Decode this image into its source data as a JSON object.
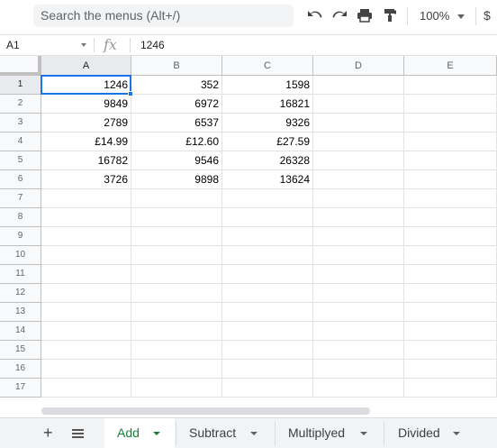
{
  "toolbar": {
    "search_placeholder": "Search the menus (Alt+/)",
    "undo_icon": "undo-icon",
    "redo_icon": "redo-icon",
    "print_icon": "print-icon",
    "paint_format_icon": "paint-format-icon",
    "zoom": "100%",
    "currency": "$"
  },
  "formula_bar": {
    "cell_ref": "A1",
    "fx": "fx",
    "value": "1246"
  },
  "columns": [
    "A",
    "B",
    "C",
    "D",
    "E"
  ],
  "rows": [
    "1",
    "2",
    "3",
    "4",
    "5",
    "6",
    "7",
    "8",
    "9",
    "10",
    "11",
    "12",
    "13",
    "14",
    "15",
    "16",
    "17"
  ],
  "cells": [
    [
      "1246",
      "352",
      "1598",
      "",
      ""
    ],
    [
      "9849",
      "6972",
      "16821",
      "",
      ""
    ],
    [
      "2789",
      "6537",
      "9326",
      "",
      ""
    ],
    [
      "£14.99",
      "£12.60",
      "£27.59",
      "",
      ""
    ],
    [
      "16782",
      "9546",
      "26328",
      "",
      ""
    ],
    [
      "3726",
      "9898",
      "13624",
      "",
      ""
    ]
  ],
  "sheets": {
    "add_icon": "+",
    "tabs": [
      "Add",
      "Subtract",
      "Multiplyed",
      "Divided"
    ],
    "active": "Add"
  },
  "colors": {
    "selection": "#1a73e8",
    "active_tab": "#188038"
  }
}
